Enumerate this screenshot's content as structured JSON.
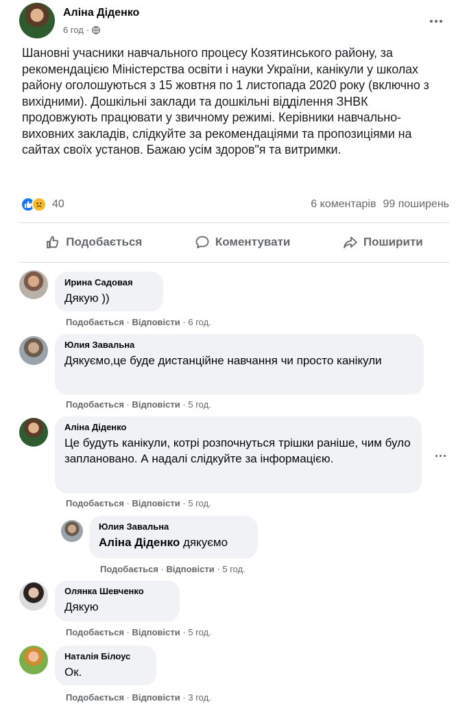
{
  "post": {
    "author": "Аліна Діденко",
    "time": "6 год",
    "sep": "·",
    "text": "Шановні учасники навчального процесу Козятинського району, за рекомендацією Міністерства освіти і науки України, канікули у школах району оголошуються з 15 жовтня по 1 листопада 2020 року (включно з вихідними). Дошкільні заклади та дошкільні відділення ЗНВК продовжують працювати у звичному режимі. Керівники навчально-виховних закладів, слідкуйте за рекомендаціями та пропозиціями на сайтах своїх установ. Бажаю усім здоров\"я та витримки.",
    "reactions_count": "40",
    "comments_count": "6 коментарів",
    "shares_count": "99 поширень"
  },
  "actions": {
    "like": "Подобається",
    "comment": "Коментувати",
    "share": "Поширити"
  },
  "comment_actions": {
    "like": "Подобається",
    "reply": "Відповісти",
    "sep": "·"
  },
  "comments": [
    {
      "name": "Ирина Садовая",
      "text": "Дякую ))",
      "time": "6 год."
    },
    {
      "name": "Юлия Завальна",
      "text": "Дякуємо,це буде дистанційне навчання чи просто канікули",
      "time": "5 год."
    },
    {
      "name": "Аліна Діденко",
      "text": "Це будуть канікули, котрі розпочнуться трішки раніше, чим було заплановано. А надалі слідкуйте за інформацією.",
      "time": "5 год."
    },
    {
      "name": "Юлия Завальна",
      "mention": "Аліна Діденко",
      "text": " дякуємо",
      "time": "5 год."
    },
    {
      "name": "Олянка Шевченко",
      "text": "Дякую",
      "time": "5 год."
    },
    {
      "name": "Наталія Білоус",
      "text": "Ок.",
      "time": "3 год."
    }
  ],
  "colors": {
    "accent": "#1877f2",
    "secondary_text": "#65676b",
    "bubble_bg": "#f0f2f5"
  }
}
